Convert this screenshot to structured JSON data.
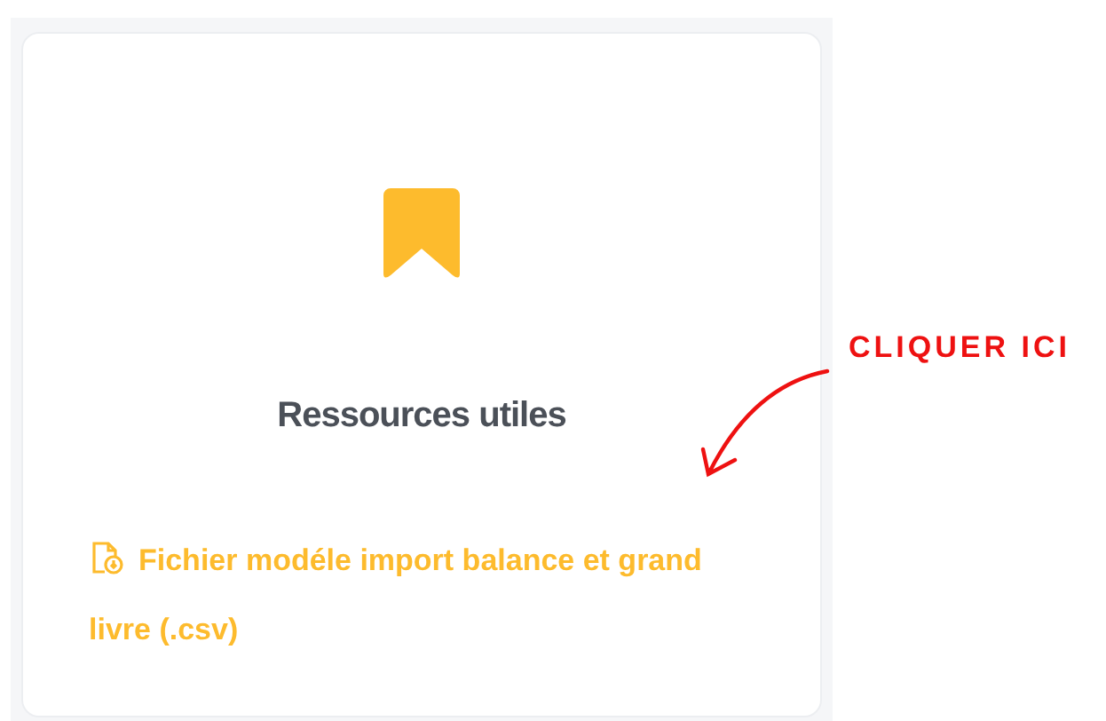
{
  "card": {
    "title": "Ressources utiles",
    "link": "Fichier modéle import balance et grand livre (.csv)"
  },
  "annotation": {
    "label": "CLIQUER ICI"
  }
}
